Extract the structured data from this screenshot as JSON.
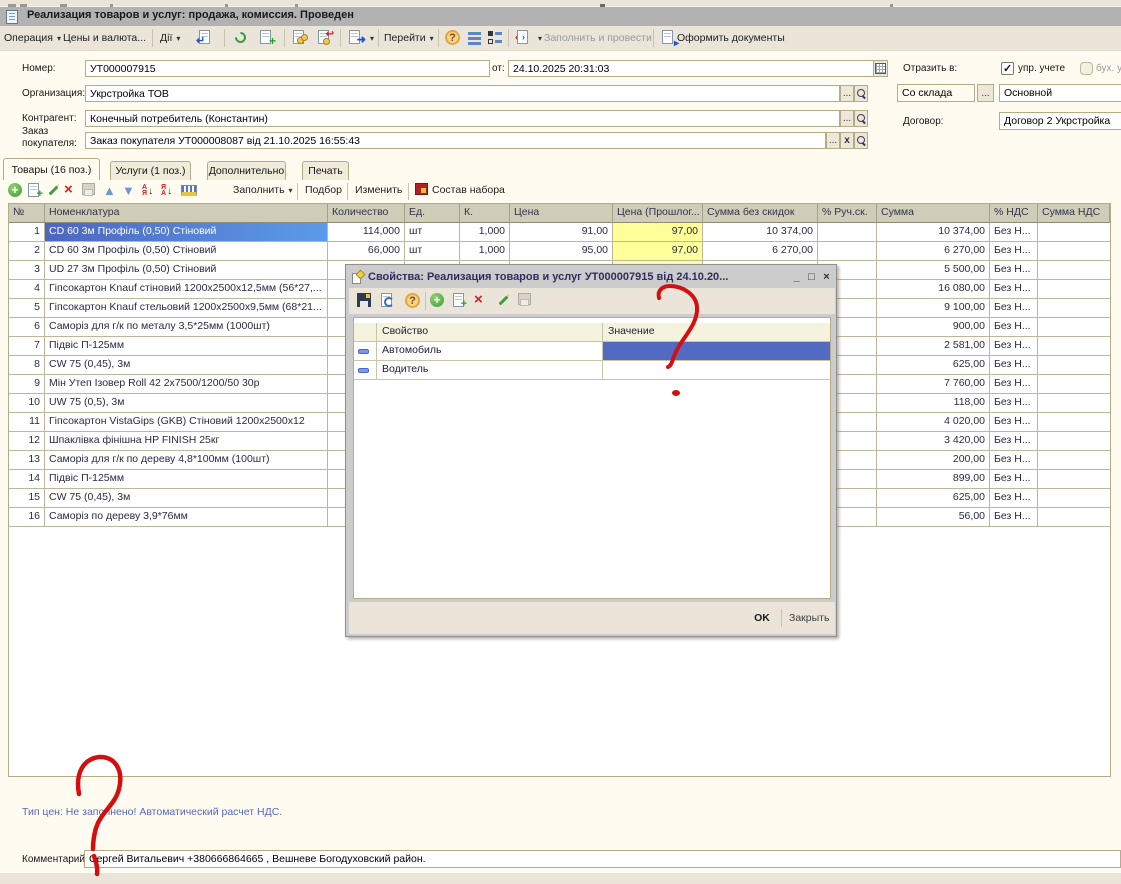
{
  "window": {
    "title": "Реализация товаров и услуг: продажа, комиссия. Проведен"
  },
  "toolbar": {
    "operation": "Операция",
    "prices": "Цены и валюта...",
    "dii": "Дії",
    "pereiti": "Перейти",
    "fill_and_post": "Заполнить и провести",
    "make_docs": "Оформить документы"
  },
  "form": {
    "number_label": "Номер:",
    "number": "УТ000007915",
    "date_label": "от:",
    "date": "24.10.2025 20:31:03",
    "org_label": "Организация:",
    "org": "Укрстройка ТОВ",
    "contr_label": "Контрагент:",
    "contr": "Конечный потребитель (Константин)",
    "order_label1": "Заказ",
    "order_label2": "покупателя:",
    "order": "Заказ покупателя УТ000008087 від 21.10.2025 16:55:43",
    "reflect_label": "Отразить в:",
    "cb1_label": "упр. учете",
    "cb2_label": "бух. у",
    "warehouse_btn": "Со склада",
    "warehouse": "Основной",
    "dogovor_label": "Договор:",
    "dogovor": "Договор 2 Укрстройка",
    "dots": "...",
    "cross": "x"
  },
  "tabs": [
    {
      "label": "Товары (16 поз.)"
    },
    {
      "label": "Услуги (1 поз.)"
    },
    {
      "label": "Дополнительно"
    },
    {
      "label": "Печать"
    }
  ],
  "goods_toolbar": {
    "fill": "Заполнить",
    "podbor": "Подбор",
    "izmenit": "Изменить",
    "sostav": "Состав набора"
  },
  "goods": {
    "headers": {
      "num": "№",
      "name": "Номенклатура",
      "qty": "Количество",
      "unit": "Ед.",
      "k": "К.",
      "price": "Цена",
      "price_old": "Цена (Прошлог...",
      "sum_nodisc": "Сумма без скидок",
      "ruch": "% Руч.ск.",
      "sum": "Сумма",
      "vat": "% НДС",
      "sum_vat": "Сумма НДС"
    },
    "rows": [
      {
        "num": "1",
        "name": "CD 60 3м Профіль (0,50) Стіновий",
        "qty": "114,000",
        "unit": "шт",
        "k": "1,000",
        "price": "91,00",
        "price_old": "97,00",
        "sum_nodisc": "10 374,00",
        "ruch": "",
        "sum": "10 374,00",
        "vat": "Без Н...",
        "sum_vat": "",
        "selected": true
      },
      {
        "num": "2",
        "name": "CD 60 3м Профіль (0,50) Стіновий",
        "qty": "66,000",
        "unit": "шт",
        "k": "1,000",
        "price": "95,00",
        "price_old": "97,00",
        "sum_nodisc": "6 270,00",
        "ruch": "",
        "sum": "6 270,00",
        "vat": "Без Н...",
        "sum_vat": ""
      },
      {
        "num": "3",
        "name": "UD 27 3м Профіль (0,50) Стіновий",
        "qty": "",
        "unit": "",
        "k": "",
        "price": "",
        "price_old": "",
        "sum_nodisc": "",
        "ruch": "",
        "sum": "5 500,00",
        "vat": "Без Н...",
        "sum_vat": ""
      },
      {
        "num": "4",
        "name": "Гіпсокартон Knauf стіновий 1200х2500х12,5мм (56*27,...",
        "qty": "",
        "unit": "",
        "k": "",
        "price": "",
        "price_old": "",
        "sum_nodisc": "",
        "ruch": "",
        "sum": "16 080,00",
        "vat": "Без Н...",
        "sum_vat": ""
      },
      {
        "num": "5",
        "name": "Гіпсокартон Knauf стельовий 1200х2500х9,5мм (68*21...",
        "qty": "",
        "unit": "",
        "k": "",
        "price": "",
        "price_old": "",
        "sum_nodisc": "",
        "ruch": "",
        "sum": "9 100,00",
        "vat": "Без Н...",
        "sum_vat": ""
      },
      {
        "num": "6",
        "name": "Саморіз для г/к по металу 3,5*25мм (1000шт)",
        "qty": "",
        "unit": "",
        "k": "",
        "price": "",
        "price_old": "",
        "sum_nodisc": "",
        "ruch": "",
        "sum": "900,00",
        "vat": "Без Н...",
        "sum_vat": ""
      },
      {
        "num": "7",
        "name": "Підвіс П-125мм",
        "qty": "",
        "unit": "",
        "k": "",
        "price": "",
        "price_old": "",
        "sum_nodisc": "",
        "ruch": "",
        "sum": "2 581,00",
        "vat": "Без Н...",
        "sum_vat": ""
      },
      {
        "num": "8",
        "name": "CW 75 (0,45), 3м",
        "qty": "",
        "unit": "",
        "k": "",
        "price": "",
        "price_old": "",
        "sum_nodisc": "",
        "ruch": "",
        "sum": "625,00",
        "vat": "Без Н...",
        "sum_vat": ""
      },
      {
        "num": "9",
        "name": "Мін Утеп Ізовер Roll 42  2х7500/1200/50 30р",
        "qty": "",
        "unit": "",
        "k": "",
        "price": "",
        "price_old": "",
        "sum_nodisc": "",
        "ruch": "",
        "sum": "7 760,00",
        "vat": "Без Н...",
        "sum_vat": ""
      },
      {
        "num": "10",
        "name": "UW 75 (0,5), 3м",
        "qty": "",
        "unit": "",
        "k": "",
        "price": "",
        "price_old": "",
        "sum_nodisc": "",
        "ruch": "",
        "sum": "118,00",
        "vat": "Без Н...",
        "sum_vat": ""
      },
      {
        "num": "11",
        "name": "Гіпсокартон VistaGips (GKB) Стіновий 1200х2500х12",
        "qty": "",
        "unit": "",
        "k": "",
        "price": "",
        "price_old": "",
        "sum_nodisc": "",
        "ruch": "",
        "sum": "4 020,00",
        "vat": "Без Н...",
        "sum_vat": ""
      },
      {
        "num": "12",
        "name": "Шпаклівка фінішна HP FINISH  25кг",
        "qty": "",
        "unit": "",
        "k": "",
        "price": "",
        "price_old": "",
        "sum_nodisc": "",
        "ruch": "",
        "sum": "3 420,00",
        "vat": "Без Н...",
        "sum_vat": ""
      },
      {
        "num": "13",
        "name": "Саморіз для г/к по дереву 4,8*100мм (100шт)",
        "qty": "",
        "unit": "",
        "k": "",
        "price": "",
        "price_old": "",
        "sum_nodisc": "",
        "ruch": "",
        "sum": "200,00",
        "vat": "Без Н...",
        "sum_vat": ""
      },
      {
        "num": "14",
        "name": "Підвіс П-125мм",
        "qty": "",
        "unit": "",
        "k": "",
        "price": "",
        "price_old": "",
        "sum_nodisc": "",
        "ruch": "",
        "sum": "899,00",
        "vat": "Без Н...",
        "sum_vat": ""
      },
      {
        "num": "15",
        "name": "CW 75 (0,45), 3м",
        "qty": "",
        "unit": "",
        "k": "",
        "price": "",
        "price_old": "",
        "sum_nodisc": "",
        "ruch": "",
        "sum": "625,00",
        "vat": "Без Н...",
        "sum_vat": ""
      },
      {
        "num": "16",
        "name": "Саморіз по дереву 3,9*76мм",
        "qty": "",
        "unit": "",
        "k": "",
        "price": "",
        "price_old": "",
        "sum_nodisc": "",
        "ruch": "",
        "sum": "56,00",
        "vat": "Без Н...",
        "sum_vat": ""
      }
    ]
  },
  "type_price_note": "Тип цен: Не заполнено! Автоматический расчет НДС.",
  "comment_label": "Комментарий:",
  "comment": "Сергей Витальевич +380666864665 , Вешневе Богодуховский район.",
  "dialog": {
    "title": "Свойства: Реализация товаров и услуг УТ000007915 від 24.10.20...",
    "minimize": "_",
    "maximize": "□",
    "close_x": "×",
    "table": {
      "prop_header": "Свойство",
      "value_header": "Значение",
      "rows": [
        {
          "prop": "Автомобиль",
          "value": "",
          "selected": true
        },
        {
          "prop": "Водитель",
          "value": ""
        }
      ]
    },
    "ok": "OK",
    "close": "Закрыть"
  },
  "annotation_color": "#d40f0f"
}
